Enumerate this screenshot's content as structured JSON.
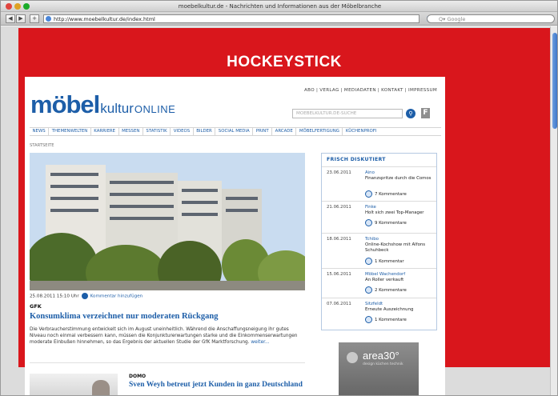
{
  "window": {
    "title": "moebelkultur.de - Nachrichten und Informationen aus der Möbelbranche"
  },
  "toolbar": {
    "back": "◀",
    "forward": "▶",
    "add": "+",
    "url": "http://www.moebelkultur.de/index.html",
    "reload": "¢",
    "search_placeholder": "Q▾ Google"
  },
  "banner": {
    "title": "HOCKEYSTICK"
  },
  "site": {
    "topnav": "ABO | VERLAG | MEDIADATEN | KONTAKT | IMPRESSUM",
    "logo": {
      "main": "möbel",
      "middle": "kultur",
      "suffix": "ONLINE"
    },
    "search_placeholder": "MOEBELKULTUR.DE-SUCHE",
    "search_button": "⚲",
    "fav_button": "F",
    "nav": [
      "NEWS",
      "THEMENWELTEN",
      "KARRIERE",
      "MESSEN",
      "STATISTIK",
      "VIDEOS",
      "BILDER",
      "SOCIAL MEDIA",
      "PRINT",
      "ARCADE",
      "MÖBELFERTIGUNG",
      "KÜCHENPROFI"
    ],
    "breadcrumb": "STARTSEITE"
  },
  "lead": {
    "date": "25.08.2011 15:10 Uhr",
    "comment_link": "Kommentar hinzufügen",
    "kicker": "GFK",
    "headline": "Konsumklima verzeichnet nur moderaten Rückgang",
    "teaser": "Die Verbraucherstimmung entwickelt sich im August uneinheitlich. Während die Anschaffungsneigung ihr gutes Niveau noch einmal verbessern kann, müssen die Konjunkturerwartungen starke und die Einkommenserwartungen moderate Einbußen hinnehmen, so das Ergebnis der aktuellen Studie der GfK Marktforschung.",
    "more": "weiter..."
  },
  "second": {
    "kicker": "DOMO",
    "headline": "Sven Weyh betreut jetzt Kunden in ganz Deutschland"
  },
  "sidebar": {
    "title": "FRISCH DISKUTIERT",
    "items": [
      {
        "date": "23.06.2011",
        "name": "Aino",
        "text": "Finanzspritze durch die Comos",
        "comments": "7 Kommentare"
      },
      {
        "date": "21.06.2011",
        "name": "Finke",
        "text": "Holt sich zwei Top-Manager",
        "comments": "9 Kommentare"
      },
      {
        "date": "18.06.2011",
        "name": "Tchibo",
        "text": "Online-Kochshow mit Alfons Schuhbeck",
        "comments": "1 Kommentar"
      },
      {
        "date": "15.06.2011",
        "name": "Möbel Wachendorf",
        "text": "An Roller verkauft",
        "comments": "2 Kommentare"
      },
      {
        "date": "07.06.2011",
        "name": "Sitzfeldt",
        "text": "Erneute Auszeichnung",
        "comments": "1 Kommentare"
      }
    ]
  },
  "ad": {
    "brand": "area30°",
    "tagline": "design küchen technik"
  }
}
